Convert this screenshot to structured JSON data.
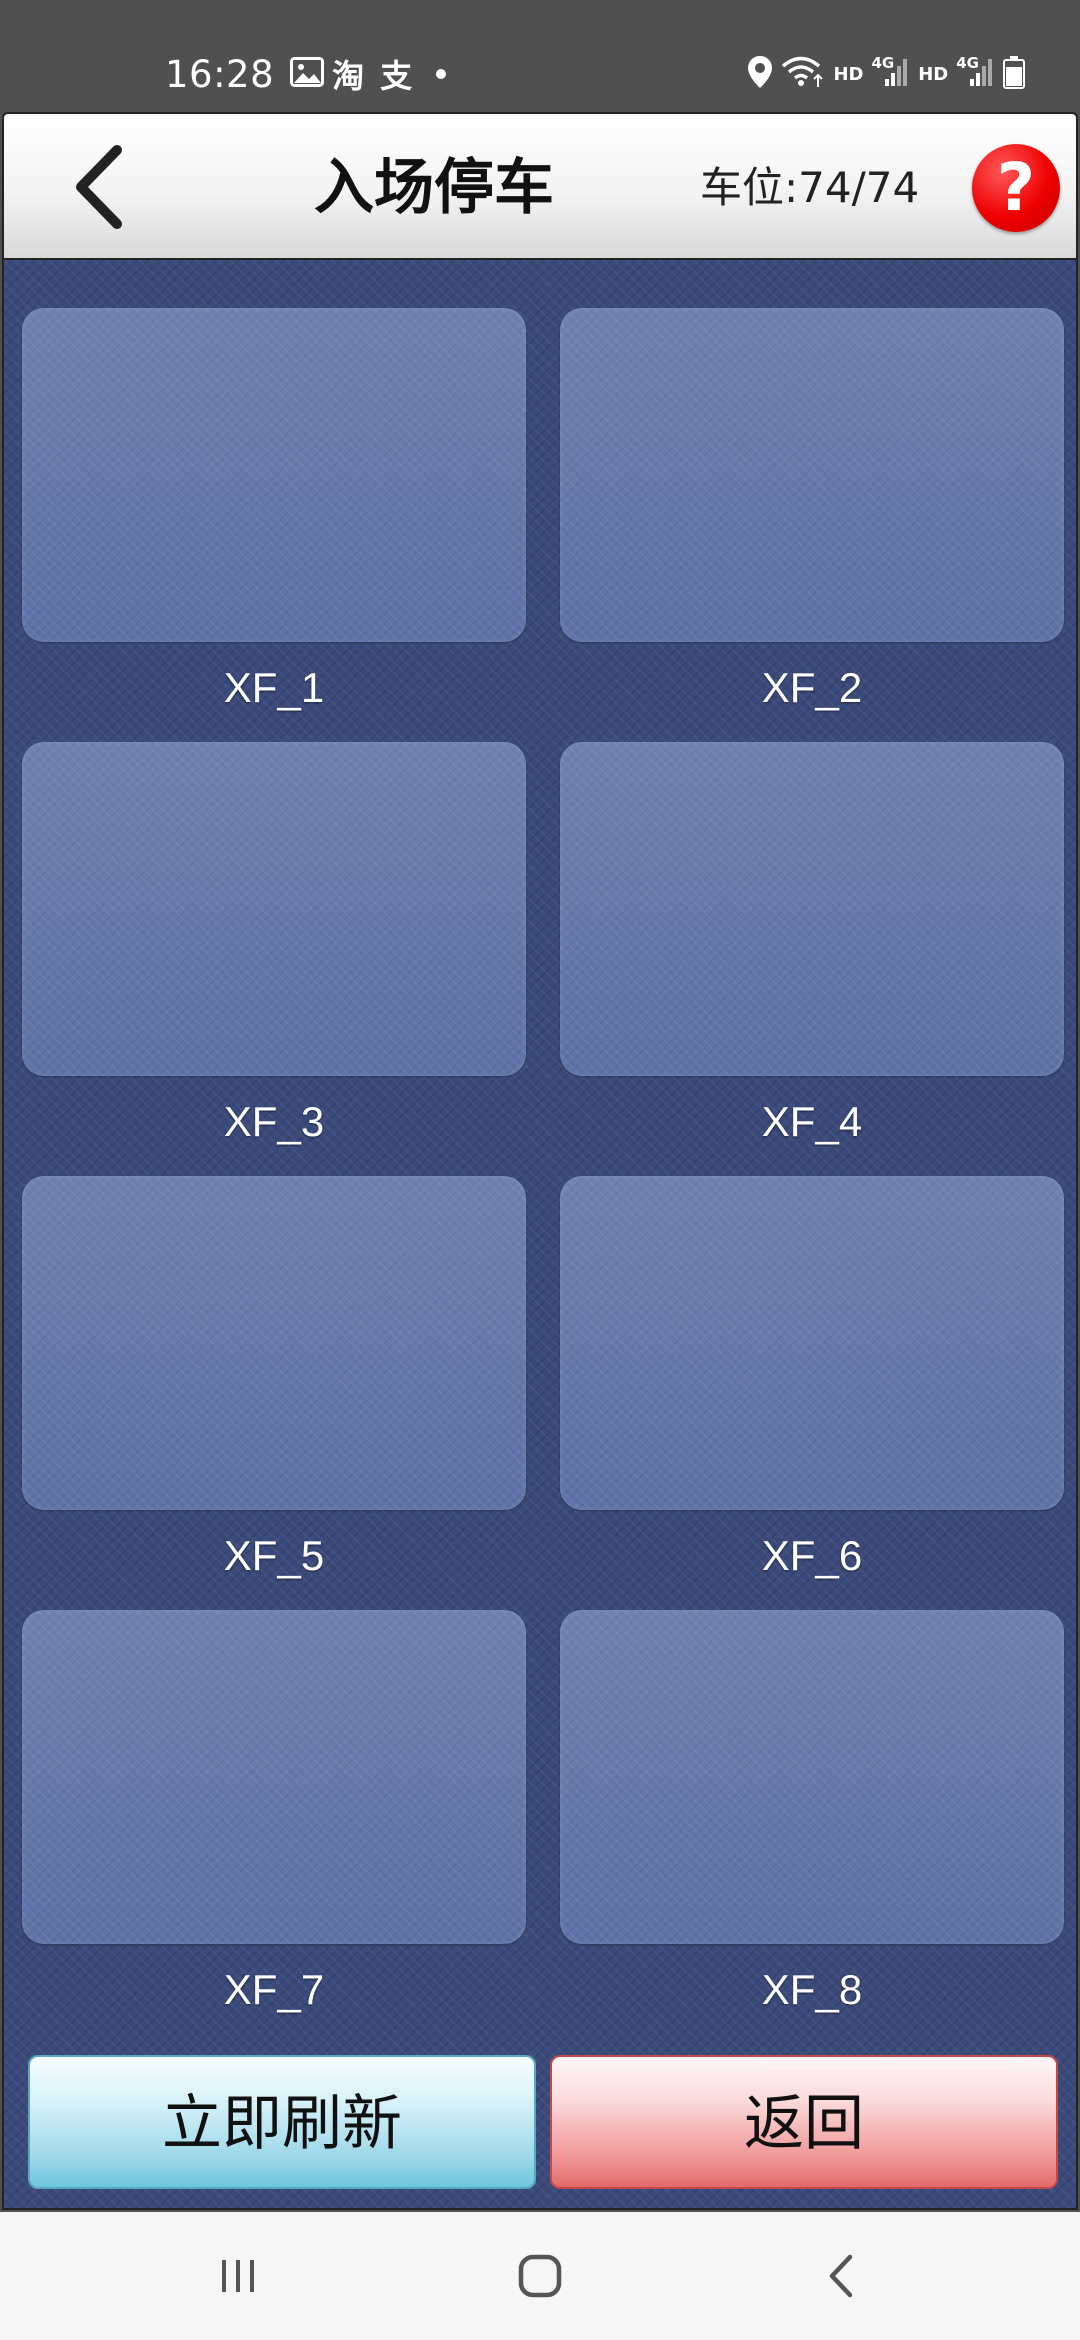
{
  "status_bar": {
    "time": "16:28",
    "notifications": [
      "image-icon",
      "淘",
      "支"
    ],
    "hd1": "HD",
    "net1": "4G",
    "hd2": "HD",
    "net2": "4G"
  },
  "header": {
    "title": "入场停车",
    "slot_count": "车位:74/74",
    "help": "?"
  },
  "slots": [
    {
      "label": "XF_1"
    },
    {
      "label": "XF_2"
    },
    {
      "label": "XF_3"
    },
    {
      "label": "XF_4"
    },
    {
      "label": "XF_5"
    },
    {
      "label": "XF_6"
    },
    {
      "label": "XF_7"
    },
    {
      "label": "XF_8"
    }
  ],
  "buttons": {
    "refresh": "立即刷新",
    "return": "返回"
  },
  "colors": {
    "background": "#3b4a7a",
    "slot": "#5b6fa4",
    "help": "#ee0000",
    "refresh": "#9fd9ea",
    "return": "#f09a9a"
  }
}
